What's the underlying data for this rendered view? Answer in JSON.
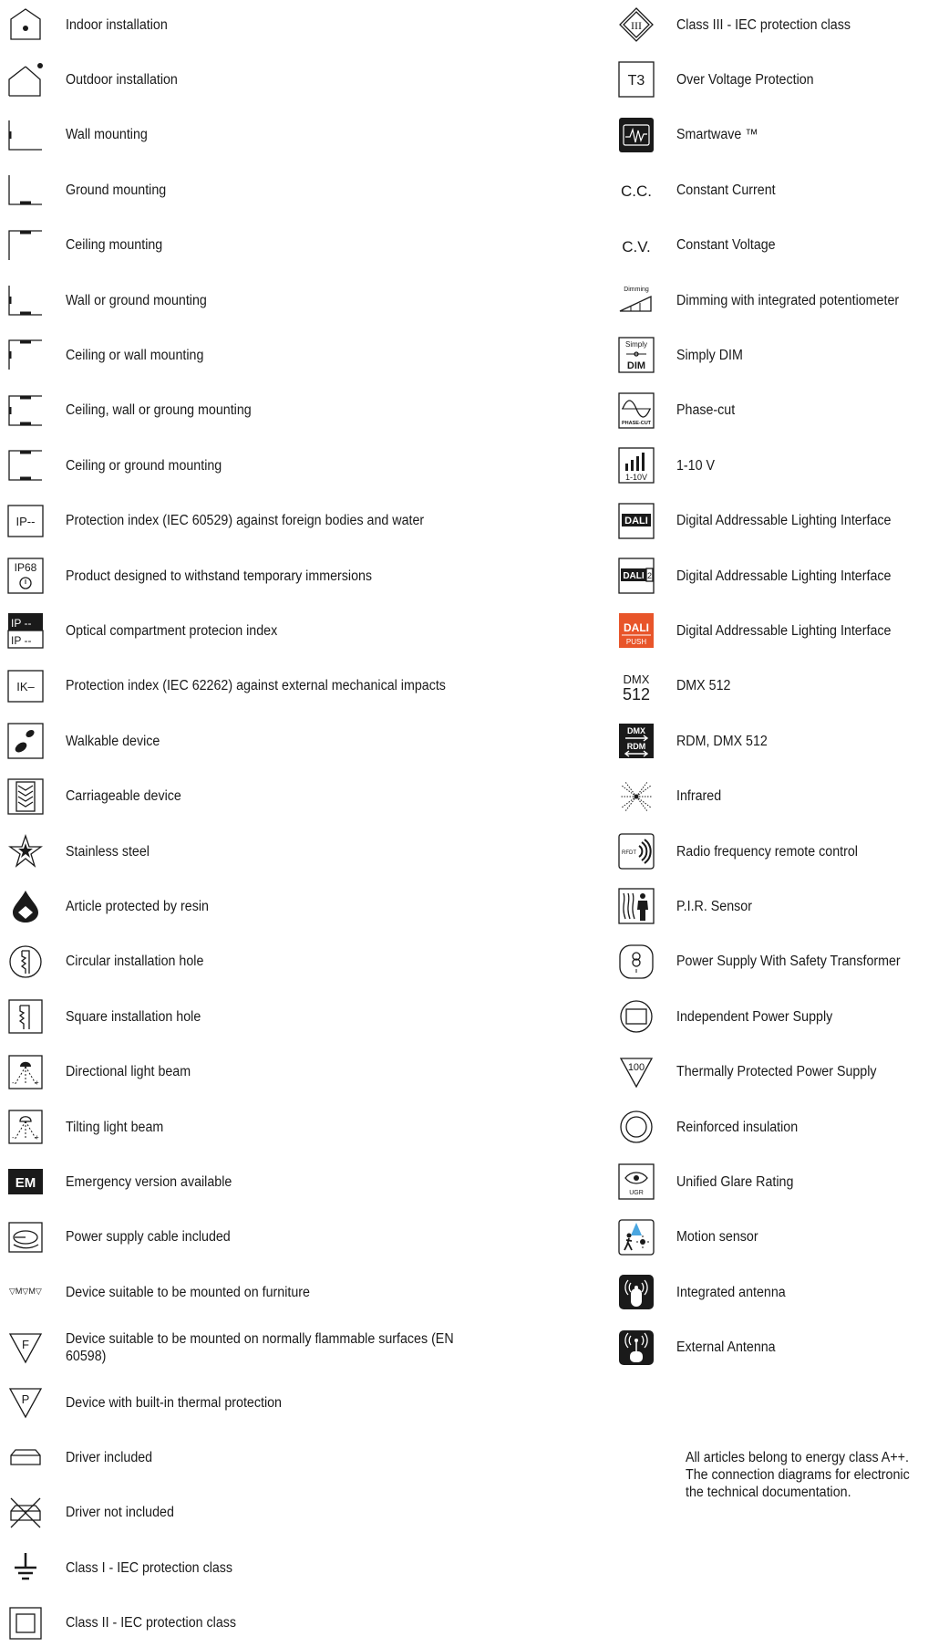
{
  "left_items": [
    {
      "icon": "indoor-installation-icon",
      "label": "Indoor installation"
    },
    {
      "icon": "outdoor-installation-icon",
      "label": "Outdoor installation"
    },
    {
      "icon": "wall-mounting-icon",
      "label": "Wall mounting"
    },
    {
      "icon": "ground-mounting-icon",
      "label": "Ground mounting"
    },
    {
      "icon": "ceiling-mounting-icon",
      "label": "Ceiling mounting"
    },
    {
      "icon": "wall-or-ground-mounting-icon",
      "label": "Wall or ground mounting"
    },
    {
      "icon": "ceiling-or-wall-mounting-icon",
      "label": "Ceiling or wall mounting"
    },
    {
      "icon": "ceiling-wall-ground-mounting-icon",
      "label": "Ceiling, wall or groung mounting"
    },
    {
      "icon": "ceiling-or-ground-mounting-icon",
      "label": "Ceiling or ground mounting"
    },
    {
      "icon": "ip-index-icon",
      "label": "Protection index (IEC 60529) against foreign bodies and water",
      "text": "IP--"
    },
    {
      "icon": "ip68-immersion-icon",
      "label": "Product designed to withstand temporary immersions",
      "text": "IP68"
    },
    {
      "icon": "optical-compartment-ip-icon",
      "label": "Optical compartment protecion index",
      "text": "IP --"
    },
    {
      "icon": "ik-index-icon",
      "label": "Protection index  (IEC 62262) against external mechanical impacts",
      "text": "IK–"
    },
    {
      "icon": "walkable-device-icon",
      "label": "Walkable device"
    },
    {
      "icon": "carriageable-device-icon",
      "label": "Carriageable device"
    },
    {
      "icon": "stainless-steel-icon",
      "label": "Stainless steel"
    },
    {
      "icon": "resin-drop-icon",
      "label": "Article protected by resin"
    },
    {
      "icon": "circular-hole-icon",
      "label": "Circular installation hole"
    },
    {
      "icon": "square-hole-icon",
      "label": "Square installation hole"
    },
    {
      "icon": "directional-beam-icon",
      "label": "Directional light beam"
    },
    {
      "icon": "tilting-beam-icon",
      "label": "Tilting light beam"
    },
    {
      "icon": "emergency-icon",
      "label": "Emergency version available",
      "text": "EM"
    },
    {
      "icon": "power-cable-icon",
      "label": "Power supply cable included"
    },
    {
      "icon": "furniture-mount-icon",
      "label": "Device suitable to be mounted on furniture",
      "text": "M M"
    },
    {
      "icon": "flammable-surface-icon",
      "label": "Device suitable to be mounted on normally flammable surfaces (EN 60598)",
      "text": "F"
    },
    {
      "icon": "thermal-protection-icon",
      "label": "Device with built-in thermal protection",
      "text": "P"
    },
    {
      "icon": "driver-included-icon",
      "label": "Driver included"
    },
    {
      "icon": "driver-not-included-icon",
      "label": "Driver not included"
    },
    {
      "icon": "class-i-ground-icon",
      "label": "Class I - IEC protection class"
    },
    {
      "icon": "class-ii-square-icon",
      "label": "Class II - IEC protection class"
    }
  ],
  "right_items": [
    {
      "icon": "class-iii-diamond-icon",
      "label": "Class III - IEC protection class",
      "text": "III"
    },
    {
      "icon": "t3-overvoltage-icon",
      "label": "Over Voltage Protection",
      "text": "T3"
    },
    {
      "icon": "smartwave-icon",
      "label": "Smartwave ™"
    },
    {
      "icon": "constant-current-icon",
      "label": "Constant Current",
      "text": "C.C."
    },
    {
      "icon": "constant-voltage-icon",
      "label": "Constant Voltage",
      "text": "C.V."
    },
    {
      "icon": "dimming-potentiometer-icon",
      "label": "Dimming with integrated potentiometer",
      "text": "Dimming"
    },
    {
      "icon": "simply-dim-icon",
      "label": "Simply DIM",
      "text": "Simply",
      "text2": "DIM"
    },
    {
      "icon": "phase-cut-icon",
      "label": "Phase-cut",
      "text": "PHASE-CUT"
    },
    {
      "icon": "one-ten-volt-icon",
      "label": "1-10 V",
      "text": "1-10V"
    },
    {
      "icon": "dali-icon",
      "label": "Digital Addressable Lighting Interface",
      "text": "DALI"
    },
    {
      "icon": "dali-2-icon",
      "label": "Digital Addressable Lighting Interface",
      "text": "DALI",
      "text2": "2"
    },
    {
      "icon": "dali-push-icon",
      "label": "Digital Addressable Lighting Interface",
      "text": "DALI",
      "text2": "PUSH"
    },
    {
      "icon": "dmx-512-icon",
      "label": "DMX 512",
      "text": "DMX",
      "text2": "512"
    },
    {
      "icon": "rdm-dmx-icon",
      "label": "RDM, DMX 512",
      "text": "DMX",
      "text2": "RDM"
    },
    {
      "icon": "infrared-icon",
      "label": "Infrared"
    },
    {
      "icon": "radio-frequency-icon",
      "label": "Radio frequency remote control",
      "text": "RFDT"
    },
    {
      "icon": "pir-sensor-icon",
      "label": "P.I.R. Sensor"
    },
    {
      "icon": "safety-transformer-icon",
      "label": "Power Supply With Safety Transformer"
    },
    {
      "icon": "independent-power-icon",
      "label": "Independent Power Supply"
    },
    {
      "icon": "thermally-protected-icon",
      "label": "Thermally Protected Power Supply",
      "text": "100"
    },
    {
      "icon": "reinforced-insulation-icon",
      "label": "Reinforced insulation"
    },
    {
      "icon": "ugr-icon",
      "label": "Unified Glare Rating",
      "text": "UGR"
    },
    {
      "icon": "motion-sensor-icon",
      "label": "Motion sensor"
    },
    {
      "icon": "integrated-antenna-icon",
      "label": "Integrated antenna"
    },
    {
      "icon": "external-antenna-icon",
      "label": "External Antenna"
    }
  ],
  "note": {
    "line1": "All articles belong to energy class A++.",
    "line2": "The connection diagrams for electronic",
    "line3": "the technical documentation."
  },
  "colors": {
    "ink": "#1a1a1a",
    "dali_push": "#e8552a",
    "motion_blue": "#4aa6e0"
  }
}
